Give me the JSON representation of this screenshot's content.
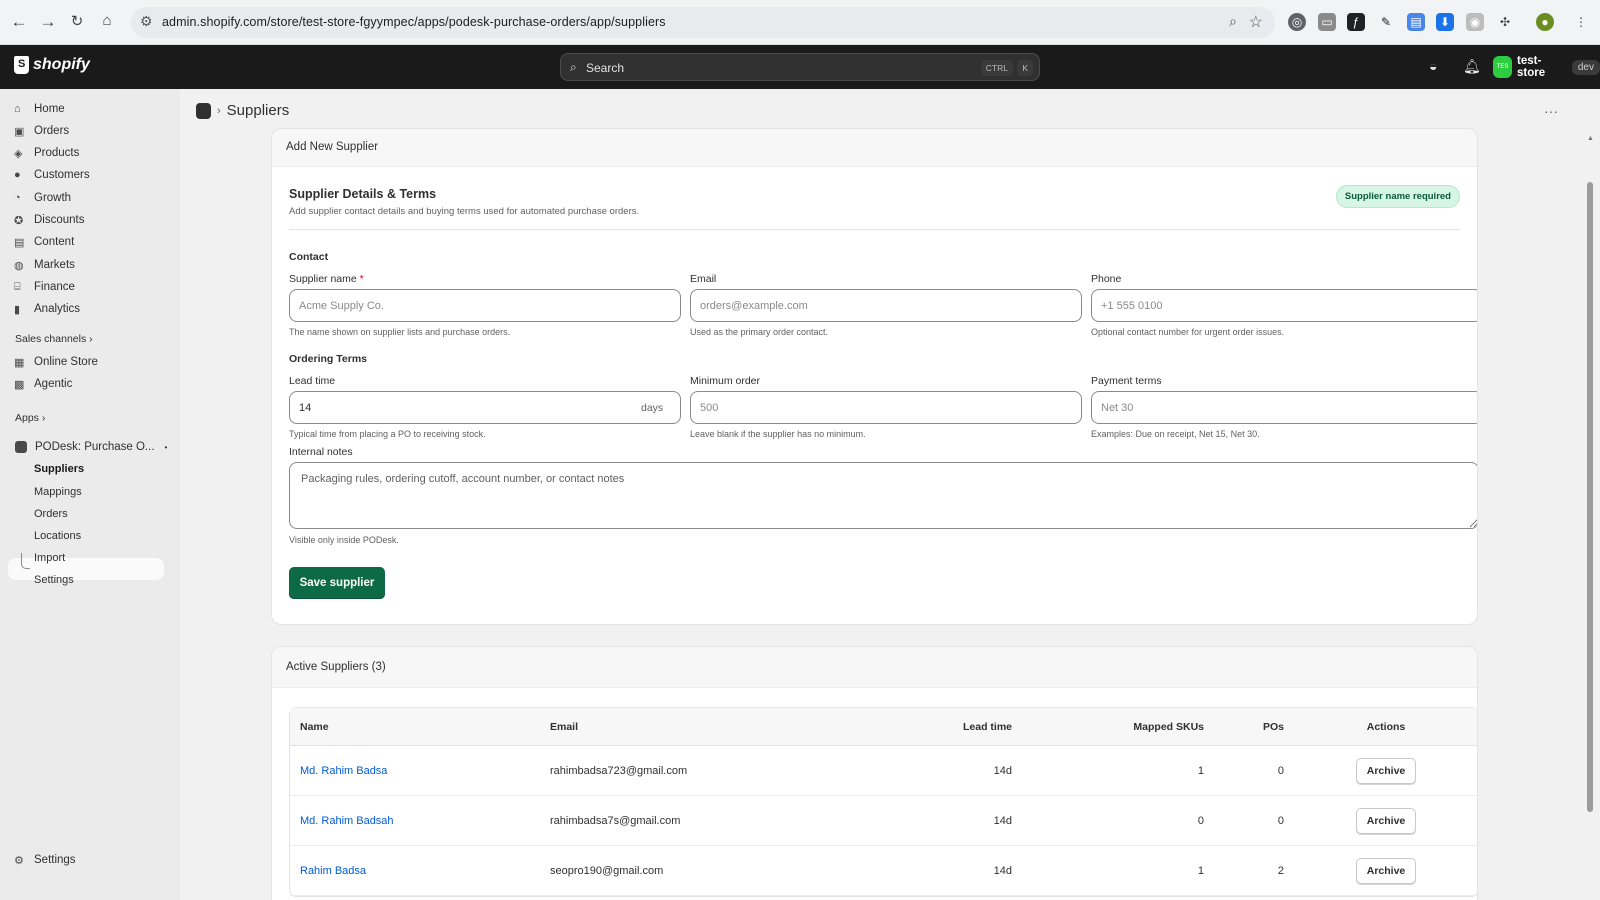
{
  "browser": {
    "url": "admin.shopify.com/store/test-store-fgyympec/apps/podesk-purchase-orders/app/suppliers"
  },
  "topbar": {
    "brand": "shopify",
    "search_placeholder": "Search",
    "shortcut_ctrl": "CTRL",
    "shortcut_key": "K",
    "store_avatar": "TES",
    "store_name": "test-store",
    "store_tag": "dev"
  },
  "sidebar": {
    "items": [
      {
        "label": "Home",
        "icon": "home-icon"
      },
      {
        "label": "Orders",
        "icon": "inbox-icon"
      },
      {
        "label": "Products",
        "icon": "tag-icon"
      },
      {
        "label": "Customers",
        "icon": "person-icon"
      },
      {
        "label": "Growth",
        "icon": "gauge-icon"
      },
      {
        "label": "Discounts",
        "icon": "discount-icon"
      },
      {
        "label": "Content",
        "icon": "content-icon"
      },
      {
        "label": "Markets",
        "icon": "globe-icon"
      },
      {
        "label": "Finance",
        "icon": "bank-icon"
      },
      {
        "label": "Analytics",
        "icon": "bar-chart-icon"
      }
    ],
    "sales_channels_label": "Sales channels",
    "channels": [
      {
        "label": "Online Store"
      },
      {
        "label": "Agentic"
      }
    ],
    "apps_label": "Apps",
    "app_name": "PODesk: Purchase O...",
    "app_subitems": [
      "Suppliers",
      "Mappings",
      "Orders",
      "Locations",
      "Import",
      "Settings"
    ],
    "settings_label": "Settings"
  },
  "page": {
    "title": "Suppliers"
  },
  "form_card": {
    "header": "Add New Supplier",
    "section_title": "Supplier Details & Terms",
    "section_desc": "Add supplier contact details and buying terms used for automated purchase orders.",
    "badge": "Supplier name required",
    "contact_heading": "Contact",
    "supplier_name": {
      "label": "Supplier name",
      "required_mark": "*",
      "placeholder": "Acme Supply Co.",
      "help": "The name shown on supplier lists and purchase orders."
    },
    "email": {
      "label": "Email",
      "placeholder": "orders@example.com",
      "help": "Used as the primary order contact."
    },
    "phone": {
      "label": "Phone",
      "placeholder": "+1 555 0100",
      "help": "Optional contact number for urgent order issues."
    },
    "terms_heading": "Ordering Terms",
    "lead_time": {
      "label": "Lead time",
      "value": "14",
      "suffix": "days",
      "help": "Typical time from placing a PO to receiving stock."
    },
    "minimum_order": {
      "label": "Minimum order",
      "placeholder": "500",
      "help": "Leave blank if the supplier has no minimum."
    },
    "payment_terms": {
      "label": "Payment terms",
      "placeholder": "Net 30",
      "help": "Examples: Due on receipt, Net 15, Net 30."
    },
    "notes": {
      "label": "Internal notes",
      "placeholder": "Packaging rules, ordering cutoff, account number, or contact notes",
      "help": "Visible only inside PODesk."
    },
    "save_label": "Save supplier"
  },
  "suppliers_card": {
    "header": "Active Suppliers (3)",
    "columns": [
      "Name",
      "Email",
      "Lead time",
      "Mapped SKUs",
      "POs",
      "Actions"
    ],
    "rows": [
      {
        "name": "Md. Rahim Badsa",
        "email": "rahimbadsa723@gmail.com",
        "lead": "14d",
        "skus": "1",
        "pos": "0",
        "action": "Archive"
      },
      {
        "name": "Md. Rahim Badsah",
        "email": "rahimbadsa7s@gmail.com",
        "lead": "14d",
        "skus": "0",
        "pos": "0",
        "action": "Archive"
      },
      {
        "name": "Rahim Badsa",
        "email": "seopro190@gmail.com",
        "lead": "14d",
        "skus": "1",
        "pos": "2",
        "action": "Archive"
      }
    ]
  },
  "colors": {
    "primary_button": "#0c6b46",
    "link": "#005bd3",
    "topbar": "#1a1a1a",
    "badge_bg": "#d6f5e3"
  }
}
